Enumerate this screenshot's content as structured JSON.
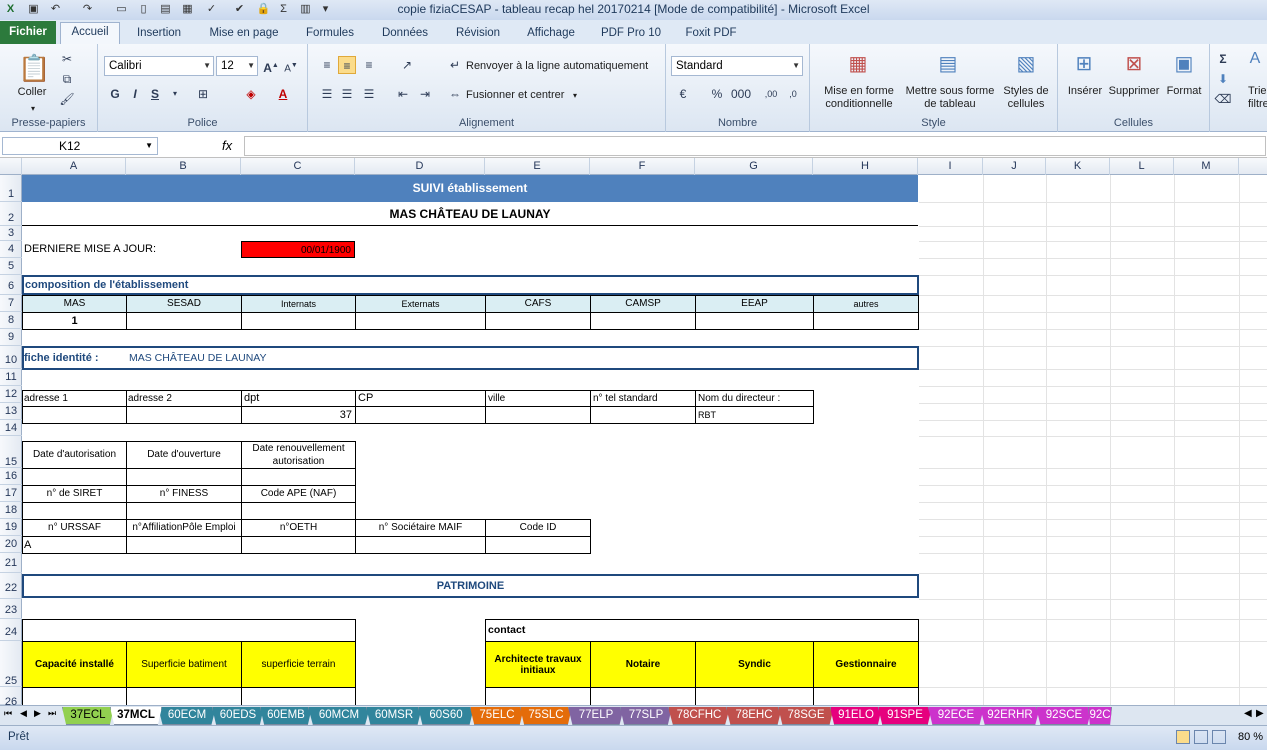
{
  "window": {
    "title": "copie fiziaCESAP - tableau recap hel 20170214  [Mode de compatibilité]  - Microsoft Excel"
  },
  "ribbon_tabs": {
    "file": "Fichier",
    "tabs": [
      "Accueil",
      "Insertion",
      "Mise en page",
      "Formules",
      "Données",
      "Révision",
      "Affichage",
      "PDF Pro 10",
      "Foxit PDF"
    ]
  },
  "ribbon": {
    "paste": "Coller",
    "clipboard_group": "Presse-papiers",
    "font_name": "Calibri",
    "font_size": "12",
    "bold": "G",
    "italic": "I",
    "underline": "S",
    "font_group": "Police",
    "wrap_text": "Renvoyer à la ligne automatiquement",
    "merge_center": "Fusionner et centrer",
    "alignment_group": "Alignement",
    "number_format": "Standard",
    "percent": "%",
    "thousands": "000",
    "number_group": "Nombre",
    "cond_format": [
      "Mise en forme",
      "conditionnelle"
    ],
    "table_format": [
      "Mettre sous forme",
      "de tableau"
    ],
    "cell_styles": [
      "Styles de",
      "cellules"
    ],
    "style_group": "Style",
    "insert": "Insérer",
    "delete": "Supprimer",
    "format": "Format",
    "cells_group": "Cellules",
    "sort": [
      "Trier",
      "filtre"
    ]
  },
  "formula_bar": {
    "name_box": "K12",
    "fx": "fx",
    "formula": ""
  },
  "columns": [
    "A",
    "B",
    "C",
    "D",
    "E",
    "F",
    "G",
    "H",
    "I",
    "J",
    "K",
    "L",
    "M"
  ],
  "rows": [
    "1",
    "2",
    "3",
    "4",
    "5",
    "6",
    "7",
    "8",
    "9",
    "10",
    "11",
    "12",
    "13",
    "14",
    "15",
    "16",
    "17",
    "18",
    "19",
    "20",
    "21",
    "22",
    "23",
    "24",
    "25",
    "26"
  ],
  "sheet": {
    "header": "SUIVI établissement",
    "establishment": "MAS CHÂTEAU DE LAUNAY",
    "last_update_label": "DERNIERE MISE A JOUR:",
    "last_update_value": "00/01/1900",
    "composition_title": "composition de l'établissement",
    "composition_headers": [
      "MAS",
      "SESAD",
      "Internats",
      "Externats",
      "CAFS",
      "CAMSP",
      "EEAP",
      "autres"
    ],
    "composition_values": [
      "1",
      "",
      "",
      "",
      "",
      "",
      "",
      ""
    ],
    "identity_label": "fiche identité :",
    "identity_value": "MAS CHÂTEAU DE LAUNAY",
    "address_headers": [
      "adresse 1",
      "adresse 2",
      "dpt",
      "CP",
      "ville",
      "n° tel standard",
      "Nom du directeur :"
    ],
    "address_values": [
      "",
      "",
      "37",
      "",
      "",
      "",
      "RBT"
    ],
    "dates_headers": [
      "Date d'autorisation",
      "Date d'ouverture",
      "Date renouvellement autorisation"
    ],
    "siret_headers": [
      "n° de SIRET",
      "n° FINESS",
      "Code APE (NAF)"
    ],
    "urssaf_headers": [
      "n° URSSAF",
      "n°AffiliationPôle Emploi",
      "n°OETH",
      "n° Sociétaire MAIF",
      "Code ID"
    ],
    "urssaf_values": [
      "A",
      "",
      "",
      "",
      ""
    ],
    "patrimoine": "PATRIMOINE",
    "patrimoine_headers": [
      "Capacité installé",
      "Superficie batiment",
      "superficie terrain"
    ],
    "contact_label": "contact",
    "contact_headers": [
      "Architecte travaux initiaux",
      "Notaire",
      "Syndic",
      "Gestionnaire"
    ]
  },
  "sheet_tabs": [
    {
      "name": "37ECL",
      "color": "#92d050"
    },
    {
      "name": "37MCL",
      "color": "#ffffff"
    },
    {
      "name": "60ECM",
      "color": "#31859c"
    },
    {
      "name": "60EDS",
      "color": "#31859c"
    },
    {
      "name": "60EMB",
      "color": "#31859c"
    },
    {
      "name": "60MCM",
      "color": "#31859c"
    },
    {
      "name": "60MSR",
      "color": "#31859c"
    },
    {
      "name": "60S60",
      "color": "#31859c"
    },
    {
      "name": "75ELC",
      "color": "#e46c0a"
    },
    {
      "name": "75SLC",
      "color": "#e46c0a"
    },
    {
      "name": "77ELP",
      "color": "#8064a2"
    },
    {
      "name": "77SLP",
      "color": "#8064a2"
    },
    {
      "name": "78CFHC",
      "color": "#c0504d"
    },
    {
      "name": "78EHC",
      "color": "#c0504d"
    },
    {
      "name": "78SGE",
      "color": "#c0504d"
    },
    {
      "name": "91ELO",
      "color": "#e6007e"
    },
    {
      "name": "91SPE",
      "color": "#e6007e"
    },
    {
      "name": "92ECE",
      "color": "#cc33cc"
    },
    {
      "name": "92ERHR",
      "color": "#cc33cc"
    },
    {
      "name": "92SCE",
      "color": "#cc33cc"
    },
    {
      "name": "92C",
      "color": "#cc33cc"
    }
  ],
  "status": {
    "ready": "Prêt",
    "zoom": "80 %"
  }
}
